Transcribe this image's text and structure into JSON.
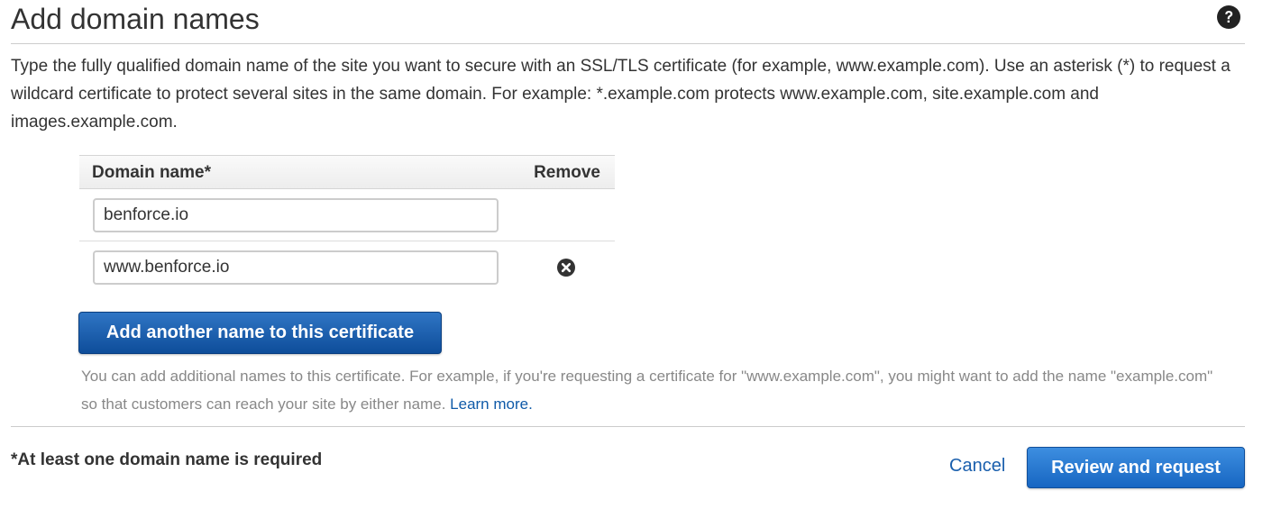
{
  "page": {
    "title": "Add domain names",
    "help_icon": "question-circle-icon",
    "description": "Type the fully qualified domain name of the site you want to secure with an SSL/TLS certificate (for example, www.example.com). Use an asterisk (*) to request a wildcard certificate to protect several sites in the same domain. For example: *.example.com protects www.example.com, site.example.com and images.example.com."
  },
  "table": {
    "header_domain": "Domain name*",
    "header_remove": "Remove",
    "rows": [
      {
        "value": "benforce.io",
        "removable": false
      },
      {
        "value": "www.benforce.io",
        "removable": true,
        "remove_icon": "remove-circle-icon"
      }
    ]
  },
  "actions": {
    "add_label": "Add another name to this certificate",
    "helper_text": "You can add additional names to this certificate. For example, if you're requesting a certificate for \"www.example.com\", you might want to add the name \"example.com\" so that customers can reach your site by either name.",
    "learn_more": "Learn more."
  },
  "footer": {
    "required_note": "*At least one domain name is required",
    "cancel_label": "Cancel",
    "review_label": "Review and request"
  },
  "colors": {
    "primary_button": "#1766c2",
    "link": "#1a5fad",
    "text": "#333333",
    "muted_text": "#888888"
  }
}
